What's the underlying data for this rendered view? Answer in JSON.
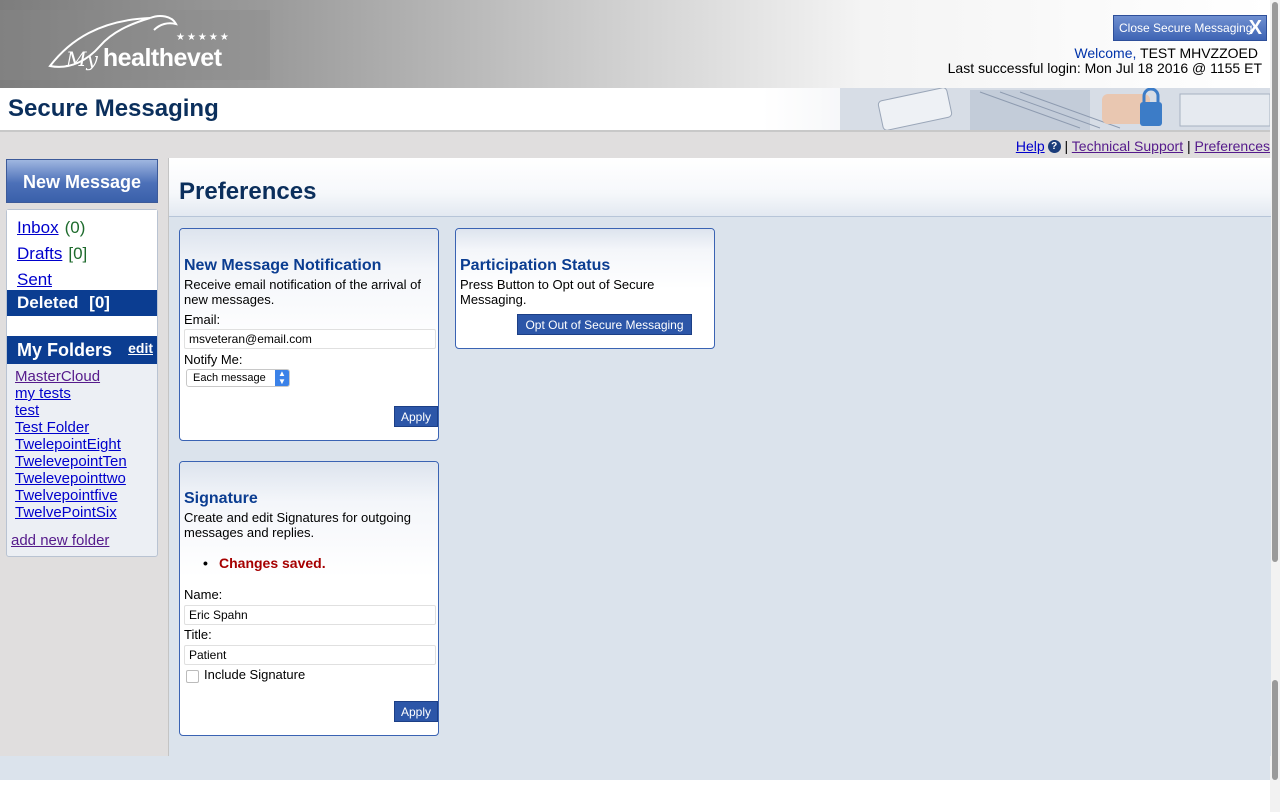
{
  "header": {
    "logo": {
      "my": "My",
      "healthevet": "healthevet",
      "stars": "★★★★★"
    },
    "close_button": "Close Secure Messaging",
    "close_icon": "X",
    "welcome_label": "Welcome,",
    "user_name": "TEST MHVZZOED",
    "last_login": "Last successful login: Mon Jul 18 2016 @ 1155 ET"
  },
  "title_bar": {
    "title": "Secure Messaging"
  },
  "top_links": {
    "help": "Help",
    "help_icon": "?",
    "sep": "|",
    "technical_support": "Technical Support",
    "preferences": "Preferences"
  },
  "sidebar": {
    "new_message": "New Message",
    "folders": [
      {
        "label": "Inbox",
        "count": "(0)"
      },
      {
        "label": "Drafts",
        "count": "[0]"
      },
      {
        "label": "Sent",
        "count": ""
      },
      {
        "label": "Deleted",
        "count": "[0]"
      }
    ],
    "my_folders_title": "My Folders",
    "edit_link": "edit",
    "custom_folders": [
      "MasterCloud",
      "my tests",
      "test",
      "Test Folder",
      "TwelepointEight",
      "TwelevepointTen",
      "Twelevepointtwo",
      "Twelvepointfive",
      "TwelvePointSix"
    ],
    "add_folder": "add new folder"
  },
  "main": {
    "title": "Preferences",
    "notification": {
      "title": "New Message Notification",
      "desc": "Receive email notification of the arrival of new messages.",
      "email_label": "Email:",
      "email_value": "msveteran@email.com",
      "notify_label": "Notify Me:",
      "notify_value": "Each message",
      "apply": "Apply"
    },
    "participation": {
      "title": "Participation Status",
      "desc": "Press Button to Opt out of Secure Messaging.",
      "button": "Opt Out of Secure Messaging"
    },
    "signature": {
      "title": "Signature",
      "desc": "Create and edit Signatures for outgoing messages and replies.",
      "status": "Changes saved.",
      "name_label": "Name:",
      "name_value": "Eric Spahn",
      "title_label": "Title:",
      "title_value": "Patient",
      "include_label": "Include Signature",
      "include_checked": false,
      "apply": "Apply"
    }
  }
}
